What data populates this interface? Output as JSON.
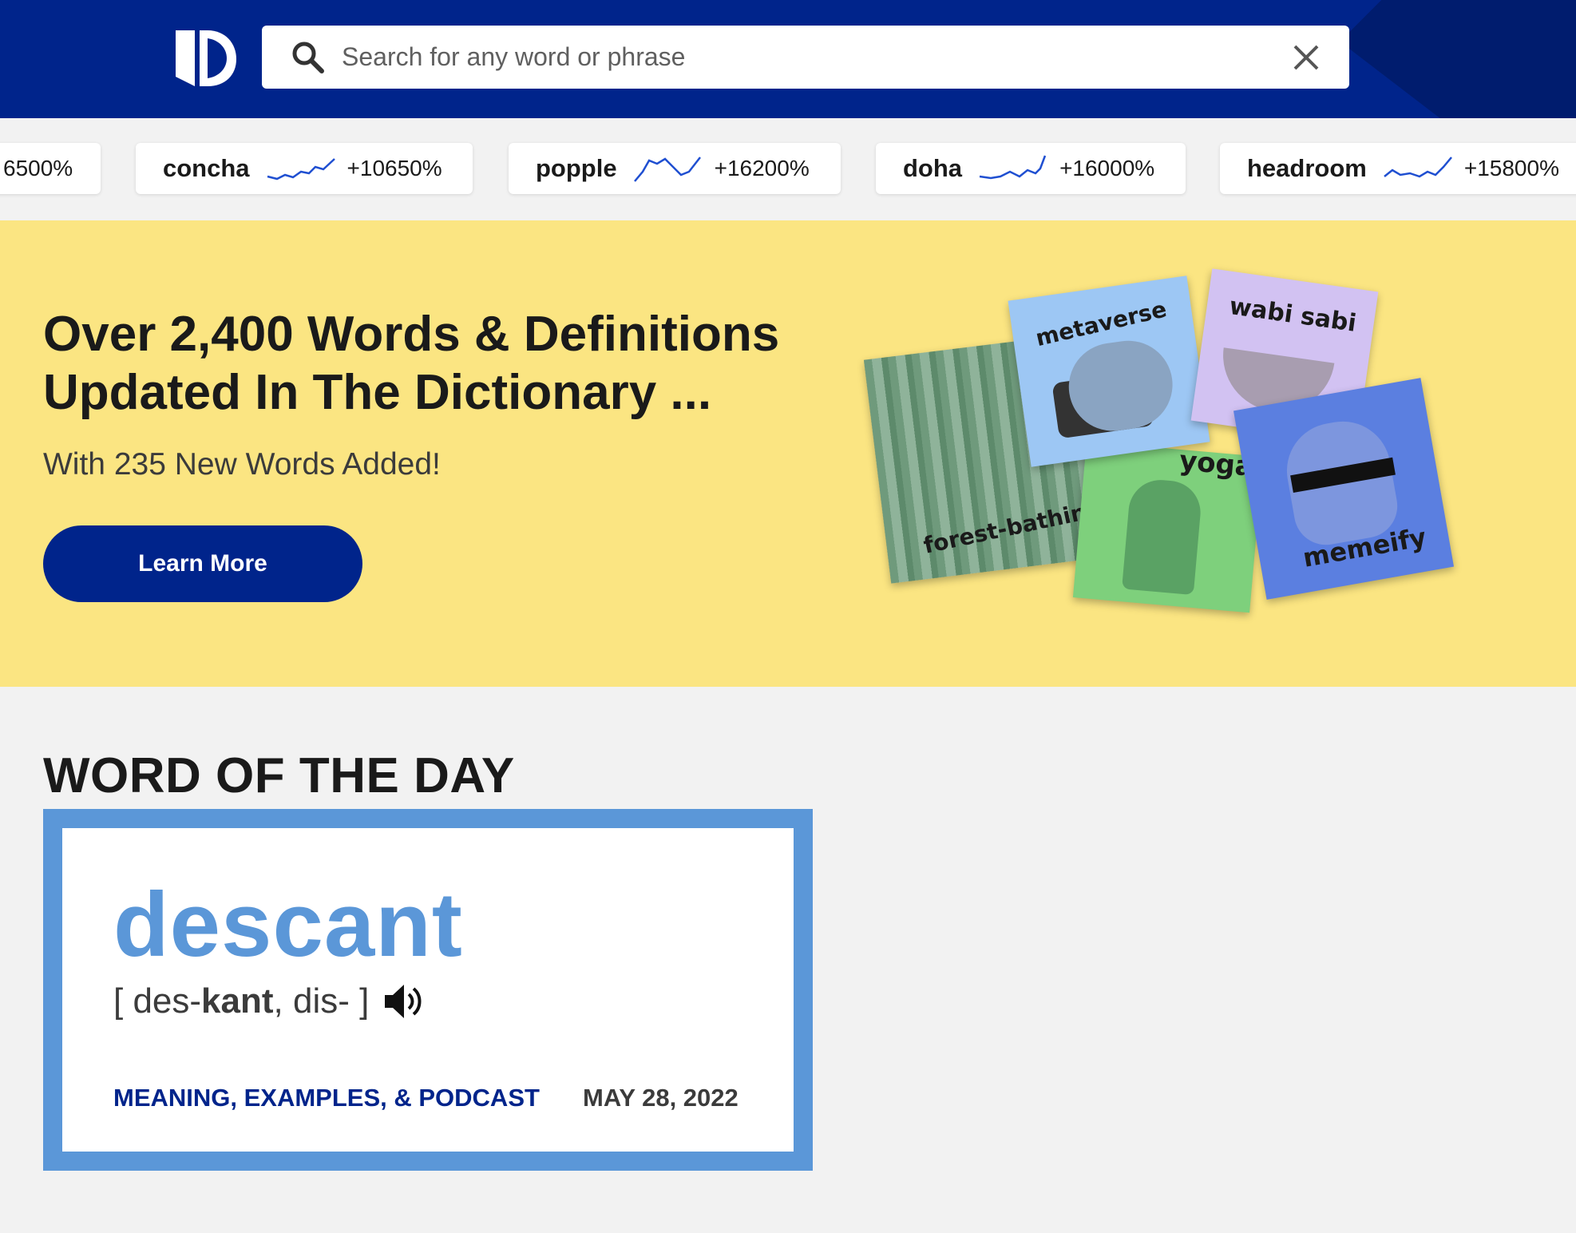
{
  "header": {
    "search_placeholder": "Search for any word or phrase",
    "brand_color": "#00248b"
  },
  "trending": [
    {
      "word": "",
      "change": "6500%"
    },
    {
      "word": "concha",
      "change": "+10650%"
    },
    {
      "word": "popple",
      "change": "+16200%"
    },
    {
      "word": "doha",
      "change": "+16000%"
    },
    {
      "word": "headroom",
      "change": "+15800%"
    }
  ],
  "promo": {
    "headline": "Over 2,400 Words & Definitions Updated In The Dictionary ...",
    "subhead": "With 235 New Words Added!",
    "button_label": "Learn More",
    "cards": [
      "forest-bathing",
      "metaverse",
      "wabi sabi",
      "yoga",
      "memeify"
    ]
  },
  "wotd": {
    "section_title": "WORD OF THE DAY",
    "word": "descant",
    "pron_open": "[ des-",
    "pron_stress": "kant",
    "pron_rest": ", dis- ]",
    "link_label": "MEANING, EXAMPLES, & PODCAST",
    "date": "MAY 28, 2022"
  }
}
